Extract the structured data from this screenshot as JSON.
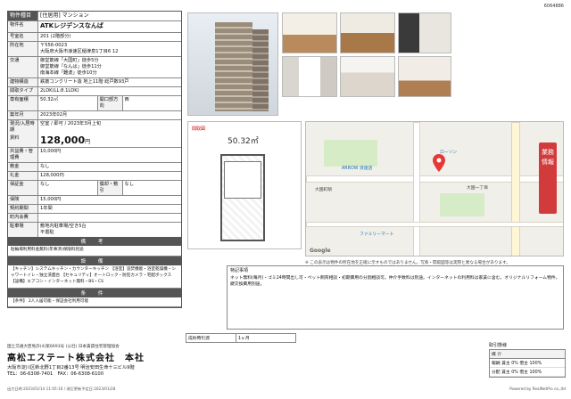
{
  "doc_id": "6064886",
  "header": {
    "label": "物件種目",
    "value": "[住居用] マンション"
  },
  "rows": [
    {
      "label": "物件名",
      "value": "ATKレジデンスなんば",
      "kind": "name"
    },
    {
      "label": "号室名",
      "value": "201 (2階部分)"
    },
    {
      "label": "所在地",
      "value": "〒556-0023\n大阪府大阪市浪速区稲津泉1丁目6 12"
    },
    {
      "label": "交通",
      "value": "御堂筋線「大国町」徒歩5分\n御堂筋線「なんば」徒歩11分\n南海本線「難波」徒歩10分"
    },
    {
      "label": "建物構造",
      "value": "鉄筋コンクリート造 地上11階 総戸数93戸"
    },
    {
      "label": "間取タイプ",
      "value": "2LDK(LL:8.1LDK)"
    },
    {
      "label": "専有面積",
      "value": "50.32㎡",
      "extra_label": "開口部方向",
      "extra_value": "西"
    },
    {
      "label": "築年月",
      "value": "2023年02月"
    },
    {
      "label": "現況/入居時期",
      "value": "空室 / 即可 / 2023年3月上旬"
    }
  ],
  "price": {
    "label": "賃料",
    "value": "128,000",
    "unit": "円"
  },
  "rows2": [
    {
      "label": "共益費・管理費",
      "value": "10,000円"
    },
    {
      "label": "敷金",
      "value": "なし"
    },
    {
      "label": "礼金",
      "value": "128,000円"
    },
    {
      "label": "保証金",
      "value": "なし",
      "extra_label": "償却・敷引",
      "extra_value": "なし"
    },
    {
      "label": "保険",
      "value": "15,000円"
    },
    {
      "label": "契約期間",
      "value": "1年間"
    },
    {
      "label": "町内会費",
      "value": ""
    },
    {
      "label": "駐車場",
      "value": "敷地内駐車場/空き5台\n平置駐"
    }
  ],
  "sections": [
    {
      "title": "備 考",
      "body": "駐輪場利用料金無料(年事済)保険料別途"
    },
    {
      "title": "設 備",
      "body": "【キッチン】システムキッチン・カウンターキッチン 【浴室】追焚機能・浴室乾燥機・シャワートイレ・独立洗面台 【セキュリティ】オートロック・防犯カメラ・宅配ボックス 【設備】エアコン・インターネット無料・BS・CS"
    },
    {
      "title": "条 件",
      "body": "【条件】 2人入居可能・保証会社利用可能"
    }
  ],
  "floorplan": {
    "badge": "間取図",
    "area": "50.32㎡"
  },
  "map": {
    "labels": [
      "ARROW 浪速店",
      "大国町駅",
      "ファミリーマート",
      "ローソン",
      "大国一丁目"
    ],
    "google": "Google",
    "note": "※ この表示は物件の所在地を正確に示すものではありません。写真・間取図等は実際と異なる場合があります。"
  },
  "stamp": "業務情報",
  "remarks": {
    "title": "特記事項",
    "body": "ネット無料(毎月)・ゴミ24時間出し可・ペット飼育相談・初期費用の分割相談可。仲介手数料は別途。インターネットの利用料は家賃に含む。オリジナルリフォーム物件。鍵交換費用別途。"
  },
  "mini": {
    "label": "成約時引渡",
    "value": "1ヶ月"
  },
  "footer": {
    "license": "国土交通大臣免許(4)第6693号 (公社) 日本賃貸住宅管理協会",
    "company": "高松エステート株式会社　本社",
    "address": "大阪市淀川区新北野1丁目2番13号 明治安田生命十三ビル9階",
    "tel": "TEL：06-6308-7401　FAX：06-6308-6100"
  },
  "trade": {
    "label": "取引態様",
    "head": "媒 介",
    "rows": [
      "報酬 賃主 0% 借主 100%",
      "分配 賃主 0% 借主 100%"
    ]
  },
  "bottom": {
    "left": "出力日時:2023/01/14 11:05:16 / 改訂更新予定日:2023/01/28",
    "right": "Powered by RealNetPro co.,ltd"
  },
  "colors": {
    "accent": "#d23b3b",
    "header": "#555555"
  }
}
